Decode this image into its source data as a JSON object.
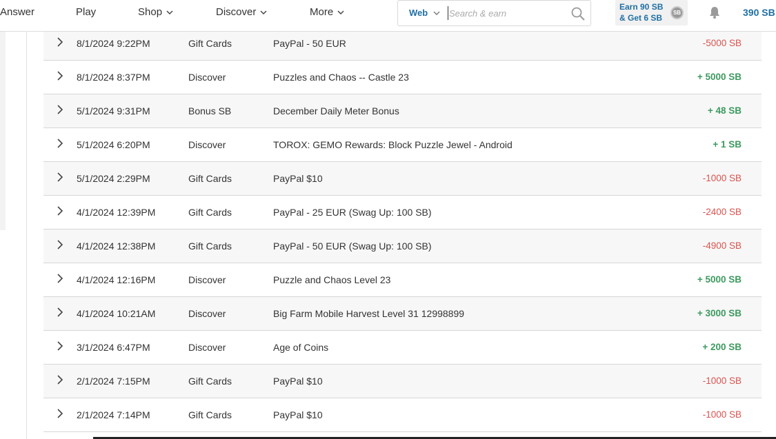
{
  "header": {
    "nav": {
      "answer": "Answer",
      "play": "Play",
      "shop": "Shop",
      "discover": "Discover",
      "more": "More"
    },
    "search": {
      "scope": "Web",
      "placeholder": "Search & earn"
    },
    "earn": {
      "line1": "Earn 90 SB",
      "line2": "& Get 6 SB",
      "coin": "SB"
    },
    "balance": "390 SB"
  },
  "colors": {
    "accent": "#1f6fa3",
    "negative": "#d9534f",
    "positive": "#3c9a5f"
  },
  "rows": [
    {
      "date": "8/1/2024 9:22PM",
      "type": "Gift Cards",
      "desc": "PayPal - 50 EUR",
      "amount": "-5000 SB",
      "sign": "neg"
    },
    {
      "date": "8/1/2024 8:37PM",
      "type": "Discover",
      "desc": "Puzzles and Chaos -- Castle 23",
      "amount": "+ 5000 SB",
      "sign": "pos"
    },
    {
      "date": "5/1/2024 9:31PM",
      "type": "Bonus SB",
      "desc": "December Daily Meter Bonus",
      "amount": "+ 48 SB",
      "sign": "pos"
    },
    {
      "date": "5/1/2024 6:20PM",
      "type": "Discover",
      "desc": "TOROX: GEMO Rewards: Block Puzzle Jewel - Android",
      "amount": "+ 1 SB",
      "sign": "pos"
    },
    {
      "date": "5/1/2024 2:29PM",
      "type": "Gift Cards",
      "desc": "PayPal $10",
      "amount": "-1000 SB",
      "sign": "neg"
    },
    {
      "date": "4/1/2024 12:39PM",
      "type": "Gift Cards",
      "desc": "PayPal - 25 EUR (Swag Up: 100 SB)",
      "amount": "-2400 SB",
      "sign": "neg"
    },
    {
      "date": "4/1/2024 12:38PM",
      "type": "Gift Cards",
      "desc": "PayPal - 50 EUR (Swag Up: 100 SB)",
      "amount": "-4900 SB",
      "sign": "neg"
    },
    {
      "date": "4/1/2024 12:16PM",
      "type": "Discover",
      "desc": "Puzzle and Chaos Level 23",
      "amount": "+ 5000 SB",
      "sign": "pos"
    },
    {
      "date": "4/1/2024 10:21AM",
      "type": "Discover",
      "desc": "Big Farm Mobile Harvest Level 31 12998899",
      "amount": "+ 3000 SB",
      "sign": "pos"
    },
    {
      "date": "3/1/2024 6:47PM",
      "type": "Discover",
      "desc": "Age of Coins",
      "amount": "+ 200 SB",
      "sign": "pos"
    },
    {
      "date": "2/1/2024 7:15PM",
      "type": "Gift Cards",
      "desc": "PayPal $10",
      "amount": "-1000 SB",
      "sign": "neg"
    },
    {
      "date": "2/1/2024 7:14PM",
      "type": "Gift Cards",
      "desc": "PayPal $10",
      "amount": "-1000 SB",
      "sign": "neg"
    }
  ]
}
